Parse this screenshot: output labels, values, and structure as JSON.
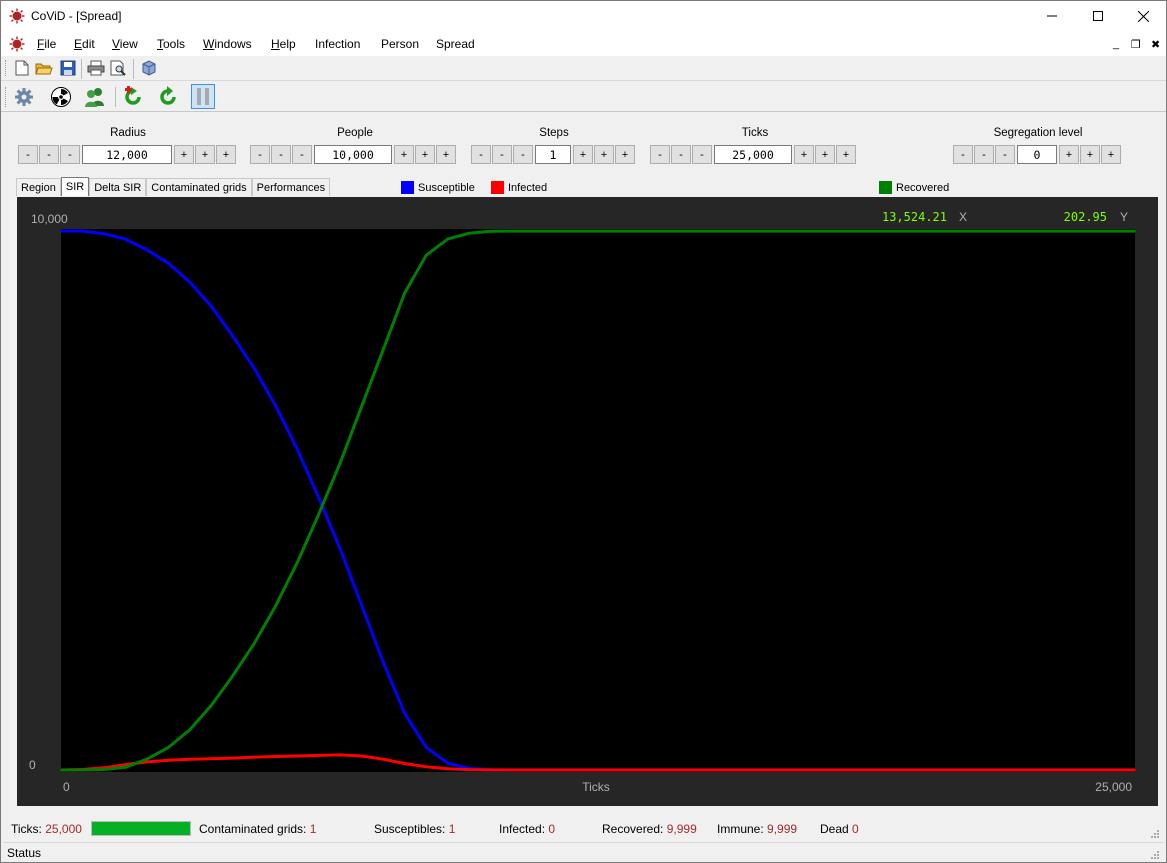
{
  "window": {
    "title": "CoViD - [Spread]"
  },
  "menu": {
    "items": [
      {
        "label": "File",
        "key": "F",
        "rest": "ile"
      },
      {
        "label": "Edit",
        "key": "E",
        "rest": "dit"
      },
      {
        "label": "View",
        "key": "V",
        "rest": "iew"
      },
      {
        "label": "Tools",
        "key": "T",
        "rest": "ools"
      },
      {
        "label": "Windows",
        "key": "W",
        "rest": "indows"
      },
      {
        "label": "Help",
        "key": "H",
        "rest": "elp"
      },
      {
        "label": "Infection",
        "key": "",
        "rest": "Infection"
      },
      {
        "label": "Person",
        "key": "",
        "rest": "Person"
      },
      {
        "label": "Spread",
        "key": "",
        "rest": "Spread"
      }
    ],
    "mdi": [
      "_",
      "❐",
      "✖"
    ]
  },
  "controls": {
    "radius": {
      "label": "Radius",
      "value": "12,000"
    },
    "people": {
      "label": "People",
      "value": "10,000"
    },
    "steps": {
      "label": "Steps",
      "value": "1"
    },
    "ticks": {
      "label": "Ticks",
      "value": "25,000"
    },
    "segregation": {
      "label": "Segregation level",
      "value": "0"
    },
    "minus": "-",
    "plus": "+"
  },
  "tabs": [
    "Region",
    "SIR",
    "Delta SIR",
    "Contaminated grids",
    "Performances"
  ],
  "active_tab": "SIR",
  "legend": {
    "susceptible": {
      "label": "Susceptible",
      "color": "#0000ff"
    },
    "infected": {
      "label": "Infected",
      "color": "#ff0000"
    },
    "recovered": {
      "label": "Recovered",
      "color": "#008000"
    }
  },
  "chart": {
    "y_max_label": "10,000",
    "y_min_label": "0",
    "x_min_label": "0",
    "x_max_label": "25,000",
    "x_title": "Ticks",
    "cursor_x": "13,524.21",
    "cursor_x_unit": "X",
    "cursor_y": "202.95",
    "cursor_y_unit": "Y"
  },
  "chart_data": {
    "type": "line",
    "xlabel": "Ticks",
    "xlim": [
      0,
      25000
    ],
    "ylim": [
      0,
      10000
    ],
    "x": [
      0,
      500,
      1000,
      1500,
      2000,
      2500,
      3000,
      3500,
      4000,
      4500,
      5000,
      5500,
      6000,
      6500,
      7000,
      7500,
      8000,
      8500,
      9000,
      9500,
      10000,
      10500,
      11000,
      11500,
      12000,
      25000
    ],
    "series": [
      {
        "name": "Susceptible",
        "color": "#0000ff",
        "values": [
          10000,
          10000,
          9950,
          9850,
          9650,
          9400,
          9050,
          8600,
          8050,
          7450,
          6750,
          5950,
          5050,
          4100,
          3050,
          2000,
          1050,
          420,
          130,
          30,
          5,
          1,
          1,
          1,
          1,
          1
        ]
      },
      {
        "name": "Infected",
        "color": "#ff0000",
        "values": [
          0,
          10,
          40,
          100,
          150,
          180,
          200,
          210,
          220,
          240,
          250,
          260,
          270,
          280,
          260,
          200,
          120,
          60,
          25,
          8,
          2,
          0,
          0,
          0,
          0,
          0
        ]
      },
      {
        "name": "Recovered",
        "color": "#008000",
        "values": [
          0,
          0,
          10,
          50,
          200,
          420,
          750,
          1200,
          1750,
          2350,
          3050,
          3850,
          4750,
          5700,
          6750,
          7800,
          8850,
          9550,
          9850,
          9960,
          9995,
          9999,
          9999,
          9999,
          9999,
          9999
        ]
      }
    ]
  },
  "status": {
    "ticks_label": "Ticks:",
    "ticks_value": "25,000",
    "progress": 1.0,
    "contaminated_label": "Contaminated grids:",
    "contaminated_value": "1",
    "susceptibles_label": "Susceptibles:",
    "susceptibles_value": "1",
    "infected_label": "Infected:",
    "infected_value": "0",
    "recovered_label": "Recovered:",
    "recovered_value": "9,999",
    "immune_label": "Immune:",
    "immune_value": "9,999",
    "dead_label": "Dead",
    "dead_value": "0",
    "bottom": "Status"
  }
}
